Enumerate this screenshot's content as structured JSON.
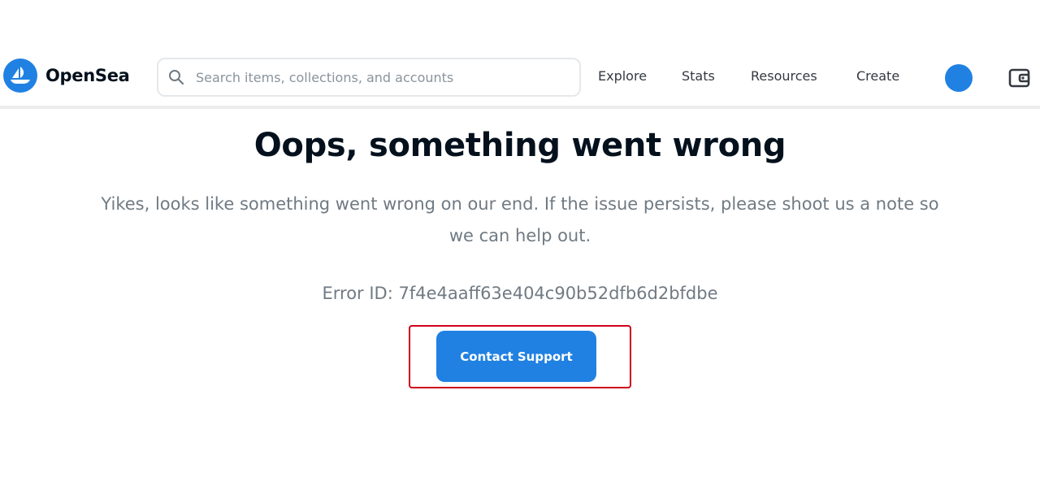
{
  "header": {
    "brand": "OpenSea",
    "search": {
      "placeholder": "Search items, collections, and accounts",
      "value": ""
    },
    "nav": [
      {
        "label": "Explore"
      },
      {
        "label": "Stats"
      },
      {
        "label": "Resources"
      },
      {
        "label": "Create"
      }
    ],
    "icons": {
      "logo": "opensea-ship-icon",
      "search": "search-icon",
      "account": "account-avatar",
      "wallet": "wallet-icon"
    }
  },
  "error": {
    "title": "Oops, something went wrong",
    "message": "Yikes, looks like something went wrong on our end. If the issue persists, please shoot us a note so we can help out.",
    "error_id": "Error ID: 7f4e4aaff63e404c90b52dfb6d2bfdbe",
    "button_label": "Contact Support"
  },
  "colors": {
    "brand": "#2081e2",
    "highlight": "#d0021b",
    "text_primary": "#04111d",
    "text_secondary": "#707a83"
  }
}
